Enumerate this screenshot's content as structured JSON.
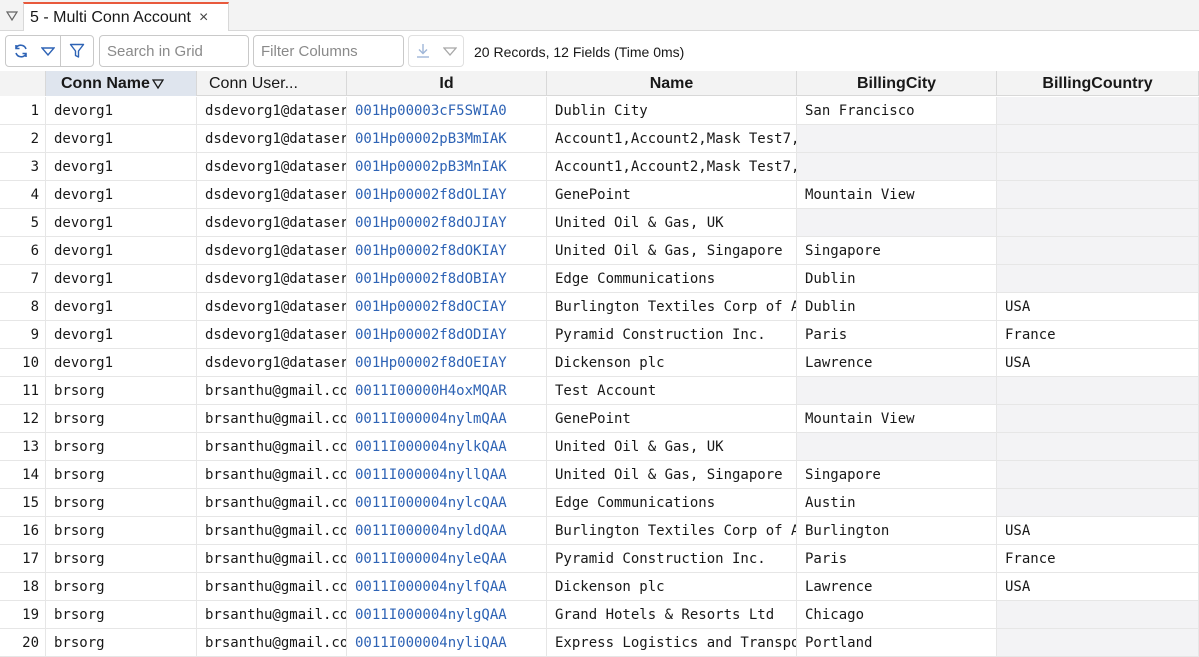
{
  "tab": {
    "label": "5 - Multi Conn Account",
    "close_glyph": "×"
  },
  "toolbar": {
    "search_placeholder": "Search in Grid",
    "filter_columns_placeholder": "Filter Columns",
    "record_info": "20 Records, 12 Fields (Time 0ms)"
  },
  "colors": {
    "accent_tab": "#e8593c",
    "link": "#2e63b5",
    "header_bg": "#f3f3f3",
    "sorted_header_bg": "#dfe5ee",
    "icon_blue": "#2e63b5"
  },
  "grid": {
    "headers": [
      "Conn Name",
      "Conn User...",
      "Id",
      "Name",
      "BillingCity",
      "BillingCountry"
    ],
    "rows": [
      {
        "n": "1",
        "conn": "devorg1",
        "user": "dsdevorg1@dataser",
        "id": "001Hp00003cF5SWIA0",
        "name": "Dublin City",
        "city": "San Francisco",
        "country": ""
      },
      {
        "n": "2",
        "conn": "devorg1",
        "user": "dsdevorg1@dataser",
        "id": "001Hp00002pB3MmIAK",
        "name": "Account1,Account2,Mask Test7,M",
        "city": "",
        "country": ""
      },
      {
        "n": "3",
        "conn": "devorg1",
        "user": "dsdevorg1@dataser",
        "id": "001Hp00002pB3MnIAK",
        "name": "Account1,Account2,Mask Test7,M",
        "city": "",
        "country": ""
      },
      {
        "n": "4",
        "conn": "devorg1",
        "user": "dsdevorg1@dataser",
        "id": "001Hp00002f8dOLIAY",
        "name": "GenePoint",
        "city": "Mountain View",
        "country": ""
      },
      {
        "n": "5",
        "conn": "devorg1",
        "user": "dsdevorg1@dataser",
        "id": "001Hp00002f8dOJIAY",
        "name": "United Oil & Gas, UK",
        "city": "",
        "country": ""
      },
      {
        "n": "6",
        "conn": "devorg1",
        "user": "dsdevorg1@dataser",
        "id": "001Hp00002f8dOKIAY",
        "name": "United Oil & Gas, Singapore",
        "city": "Singapore",
        "country": ""
      },
      {
        "n": "7",
        "conn": "devorg1",
        "user": "dsdevorg1@dataser",
        "id": "001Hp00002f8dOBIAY",
        "name": "Edge Communications",
        "city": "Dublin",
        "country": ""
      },
      {
        "n": "8",
        "conn": "devorg1",
        "user": "dsdevorg1@dataser",
        "id": "001Hp00002f8dOCIAY",
        "name": "Burlington Textiles Corp of Am",
        "city": "Dublin",
        "country": "USA"
      },
      {
        "n": "9",
        "conn": "devorg1",
        "user": "dsdevorg1@dataser",
        "id": "001Hp00002f8dODIAY",
        "name": "Pyramid Construction Inc.",
        "city": "Paris",
        "country": "France"
      },
      {
        "n": "10",
        "conn": "devorg1",
        "user": "dsdevorg1@dataser",
        "id": "001Hp00002f8dOEIAY",
        "name": "Dickenson plc",
        "city": "Lawrence",
        "country": "USA"
      },
      {
        "n": "11",
        "conn": "brsorg",
        "user": "brsanthu@gmail.cor",
        "id": "0011I00000H4oxMQAR",
        "name": "Test Account",
        "city": "",
        "country": ""
      },
      {
        "n": "12",
        "conn": "brsorg",
        "user": "brsanthu@gmail.cor",
        "id": "0011I000004nylmQAA",
        "name": "GenePoint",
        "city": "Mountain View",
        "country": ""
      },
      {
        "n": "13",
        "conn": "brsorg",
        "user": "brsanthu@gmail.cor",
        "id": "0011I000004nylkQAA",
        "name": "United Oil & Gas, UK",
        "city": "",
        "country": ""
      },
      {
        "n": "14",
        "conn": "brsorg",
        "user": "brsanthu@gmail.cor",
        "id": "0011I000004nyllQAA",
        "name": "United Oil & Gas, Singapore",
        "city": "Singapore",
        "country": ""
      },
      {
        "n": "15",
        "conn": "brsorg",
        "user": "brsanthu@gmail.cor",
        "id": "0011I000004nylcQAA",
        "name": "Edge Communications",
        "city": "Austin",
        "country": ""
      },
      {
        "n": "16",
        "conn": "brsorg",
        "user": "brsanthu@gmail.cor",
        "id": "0011I000004nyldQAA",
        "name": "Burlington Textiles Corp of Am",
        "city": "Burlington",
        "country": "USA"
      },
      {
        "n": "17",
        "conn": "brsorg",
        "user": "brsanthu@gmail.cor",
        "id": "0011I000004nyleQAA",
        "name": "Pyramid Construction Inc.",
        "city": "Paris",
        "country": "France"
      },
      {
        "n": "18",
        "conn": "brsorg",
        "user": "brsanthu@gmail.cor",
        "id": "0011I000004nylfQAA",
        "name": "Dickenson plc",
        "city": "Lawrence",
        "country": "USA"
      },
      {
        "n": "19",
        "conn": "brsorg",
        "user": "brsanthu@gmail.cor",
        "id": "0011I000004nylgQAA",
        "name": "Grand Hotels & Resorts Ltd",
        "city": "Chicago",
        "country": ""
      },
      {
        "n": "20",
        "conn": "brsorg",
        "user": "brsanthu@gmail.cor",
        "id": "0011I000004nyliQAA",
        "name": "Express Logistics and Transpor",
        "city": "Portland",
        "country": ""
      }
    ]
  }
}
